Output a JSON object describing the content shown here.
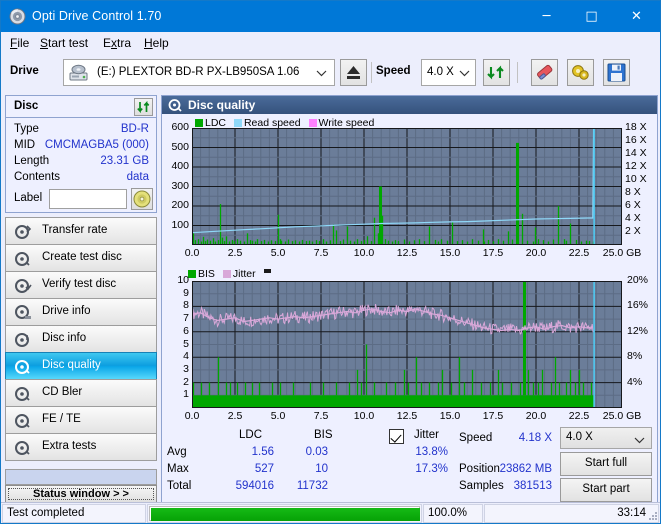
{
  "window": {
    "title": "Opti Drive Control 1.70",
    "icon": "disc-icon",
    "minimize": "─",
    "maximize": "□",
    "close": "✕"
  },
  "menu": [
    {
      "label": "File",
      "accel": "F"
    },
    {
      "label": "Start test",
      "accel": "S"
    },
    {
      "label": "Extra",
      "accel": "x"
    },
    {
      "label": "Help",
      "accel": "H"
    }
  ],
  "toolbar": {
    "drive_label": "Drive",
    "drive_value": "(E:)   PLEXTOR BD-R  PX-LB950SA 1.06",
    "drive_icon": "drive-icon",
    "eject_icon": "eject-icon",
    "speed_label": "Speed",
    "speed_value": "4.0 X",
    "refresh_icon": "refresh-icon",
    "erase_icon": "eraser-icon",
    "settings_icon": "gears-icon",
    "save_icon": "floppy-save-icon"
  },
  "disc": {
    "header": "Disc",
    "refresh_icon": "refresh-icon",
    "rows": [
      {
        "key": "Type",
        "value": "BD-R"
      },
      {
        "key": "MID",
        "value": "CMCMAGBA5 (000)"
      },
      {
        "key": "Length",
        "value": "23.31 GB"
      },
      {
        "key": "Contents",
        "value": "data"
      }
    ],
    "label_key": "Label",
    "label_value": "",
    "label_placeholder": "",
    "label_button_icon": "cd-disc-icon"
  },
  "nav": {
    "items": [
      {
        "label": "Transfer rate",
        "icon": "disc-transfer-icon",
        "selected": false
      },
      {
        "label": "Create test disc",
        "icon": "disc-create-icon",
        "selected": false
      },
      {
        "label": "Verify test disc",
        "icon": "disc-verify-icon",
        "selected": false
      },
      {
        "label": "Drive info",
        "icon": "drive-info-icon",
        "selected": false
      },
      {
        "label": "Disc info",
        "icon": "disc-info-icon",
        "selected": false
      },
      {
        "label": "Disc quality",
        "icon": "disc-quality-icon",
        "selected": true
      },
      {
        "label": "CD Bler",
        "icon": "disc-bler-icon",
        "selected": false
      },
      {
        "label": "FE / TE",
        "icon": "disc-fete-icon",
        "selected": false
      },
      {
        "label": "Extra tests",
        "icon": "disc-extra-icon",
        "selected": false
      }
    ],
    "status_window": "Status window > >"
  },
  "panel": {
    "title": "Disc quality",
    "icon": "disc-quality-icon"
  },
  "stats": {
    "col_ldc": "LDC",
    "col_bis": "BIS",
    "jitter_label": "Jitter",
    "jitter_checked": true,
    "row_avg": "Avg",
    "row_max": "Max",
    "row_total": "Total",
    "avg_ldc": "1.56",
    "avg_bis": "0.03",
    "avg_jitter": "13.8%",
    "max_ldc": "527",
    "max_bis": "10",
    "max_jitter": "17.3%",
    "total_ldc": "594016",
    "total_bis": "11732",
    "speed_label": "Speed",
    "speed_value": "4.18 X",
    "position_label": "Position",
    "position_value": "23862 MB",
    "samples_label": "Samples",
    "samples_value": "381513",
    "speed_select": "4.0 X",
    "start_full": "Start full",
    "start_part": "Start part"
  },
  "statusbar": {
    "message": "Test completed",
    "percent": "100.0%",
    "percent_value": 100,
    "elapsed": "33:14"
  },
  "colors": {
    "accent": "#0078d7",
    "ldc_green": "#00a800",
    "read_speed": "#8fd8f8",
    "write_speed": "#ff80ff",
    "jitter_pink": "#d9a8d9",
    "plot_bg": "#6b7d99",
    "value_blue": "#2233cc",
    "progress_green": "#09a809"
  },
  "chart_data": [
    {
      "type": "line",
      "name": "ldc-chart",
      "title": "",
      "xlabel": "GB",
      "ylabel": "",
      "xlim": [
        0,
        25
      ],
      "ylim": [
        0,
        600
      ],
      "y2lim": [
        0,
        18
      ],
      "y2label": "X",
      "grid": true,
      "legend_position": "top-left",
      "legend": [
        {
          "label": "LDC",
          "color": "#00a800"
        },
        {
          "label": "Read speed",
          "color": "#8fd8f8"
        },
        {
          "label": "Write speed",
          "color": "#ff80ff"
        }
      ],
      "yticks": [
        100,
        200,
        300,
        400,
        500,
        600
      ],
      "y2ticks": [
        "2 X",
        "4 X",
        "6 X",
        "8 X",
        "10 X",
        "12 X",
        "14 X",
        "16 X",
        "18 X"
      ],
      "xticks": [
        "0.0",
        "2.5",
        "5.0",
        "7.5",
        "10.0",
        "12.5",
        "15.0",
        "17.5",
        "20.0",
        "22.5",
        "25.0 GB"
      ],
      "series": [
        {
          "name": "LDC",
          "color": "#00a800",
          "render": "bars",
          "x": [
            0.05,
            0.2,
            0.35,
            0.5,
            0.62,
            0.78,
            0.9,
            1.05,
            1.2,
            1.35,
            1.5,
            1.62,
            1.72,
            1.85,
            2.0,
            2.15,
            2.3,
            2.45,
            2.6,
            2.8,
            3.0,
            3.2,
            3.4,
            3.5,
            3.65,
            3.8,
            4.0,
            4.2,
            4.4,
            4.6,
            4.8,
            5.0,
            5.1,
            5.2,
            5.4,
            5.6,
            5.8,
            6.0,
            6.2,
            6.4,
            6.6,
            6.8,
            7.0,
            7.2,
            7.4,
            7.6,
            7.8,
            8.0,
            8.2,
            8.4,
            8.6,
            8.8,
            9.0,
            9.2,
            9.4,
            9.6,
            9.8,
            10.0,
            10.2,
            10.4,
            10.6,
            10.8,
            10.95,
            11.05,
            11.2,
            11.4,
            11.6,
            11.8,
            12.0,
            12.3,
            12.6,
            12.9,
            13.2,
            13.5,
            13.8,
            14.1,
            14.3,
            14.5,
            14.8,
            15.1,
            15.4,
            15.7,
            16.0,
            16.3,
            16.6,
            16.9,
            17.0,
            17.2,
            17.5,
            17.8,
            18.1,
            18.4,
            18.6,
            18.9,
            19.2,
            19.5,
            19.8,
            19.95,
            20.1,
            20.4,
            20.7,
            21.0,
            21.3,
            21.6,
            21.75,
            22.0,
            22.3,
            22.6,
            22.9,
            23.1,
            23.3
          ],
          "values": [
            60,
            25,
            30,
            18,
            42,
            20,
            28,
            22,
            35,
            18,
            25,
            210,
            38,
            20,
            44,
            18,
            26,
            20,
            30,
            22,
            18,
            60,
            25,
            22,
            18,
            30,
            20,
            26,
            18,
            24,
            20,
            155,
            30,
            22,
            18,
            28,
            20,
            24,
            18,
            26,
            20,
            22,
            18,
            25,
            20,
            30,
            18,
            24,
            105,
            75,
            20,
            28,
            95,
            22,
            18,
            30,
            20,
            26,
            45,
            20,
            140,
            60,
            300,
            150,
            30,
            22,
            18,
            25,
            20,
            28,
            18,
            24,
            30,
            20,
            95,
            26,
            18,
            30,
            22,
            118,
            20,
            25,
            18,
            30,
            22,
            80,
            18,
            26,
            20,
            30,
            22,
            70,
            28,
            524,
            160,
            22,
            18,
            90,
            30,
            25,
            18,
            28,
            200,
            30,
            22,
            110,
            26,
            18,
            22,
            20,
            18
          ]
        },
        {
          "name": "Read speed",
          "color": "#8fd8f8",
          "render": "line",
          "axis": "y2",
          "x": [
            0.0,
            1.0,
            2.0,
            3.0,
            4.0,
            5.0,
            6.0,
            7.0,
            8.0,
            9.0,
            10.0,
            11.0,
            12.0,
            13.0,
            14.0,
            15.0,
            16.0,
            17.0,
            18.0,
            19.0,
            20.0,
            21.0,
            22.0,
            23.0,
            23.3,
            23.35
          ],
          "values": [
            1.9,
            2.05,
            2.2,
            2.35,
            2.5,
            2.65,
            2.8,
            2.9,
            3.0,
            3.1,
            3.2,
            3.3,
            3.35,
            3.4,
            3.5,
            3.55,
            3.6,
            3.7,
            3.8,
            3.9,
            4.0,
            4.05,
            4.1,
            4.15,
            4.15,
            18.0
          ]
        }
      ]
    },
    {
      "type": "line",
      "name": "bis-jitter-chart",
      "title": "",
      "xlabel": "GB",
      "ylabel": "",
      "xlim": [
        0,
        25
      ],
      "ylim": [
        0,
        10
      ],
      "y2lim": [
        0,
        20
      ],
      "y2label": "%",
      "grid": true,
      "legend_position": "top-left",
      "legend": [
        {
          "label": "BIS",
          "color": "#00a800"
        },
        {
          "label": "Jitter",
          "color": "#d9a8d9"
        }
      ],
      "yticks": [
        1,
        2,
        3,
        4,
        5,
        6,
        7,
        8,
        9,
        10
      ],
      "y2ticks": [
        "4%",
        "8%",
        "12%",
        "16%",
        "20%"
      ],
      "xticks": [
        "0.0",
        "2.5",
        "5.0",
        "7.5",
        "10.0",
        "12.5",
        "15.0",
        "17.5",
        "20.0",
        "22.5",
        "25.0 GB"
      ],
      "series": [
        {
          "name": "BIS",
          "color": "#00a800",
          "render": "bars",
          "baseline": 1,
          "x": [
            0.05,
            0.3,
            0.55,
            0.8,
            1.0,
            1.25,
            1.5,
            1.72,
            1.95,
            2.2,
            2.4,
            2.6,
            2.85,
            3.1,
            3.3,
            3.5,
            3.7,
            3.9,
            4.15,
            4.4,
            4.65,
            4.9,
            5.1,
            5.35,
            5.6,
            5.85,
            6.1,
            6.35,
            6.6,
            6.85,
            7.1,
            7.35,
            7.6,
            7.85,
            8.1,
            8.35,
            8.6,
            8.85,
            9.1,
            9.35,
            9.6,
            9.85,
            10.1,
            10.35,
            10.6,
            10.85,
            11.05,
            11.3,
            11.55,
            11.8,
            12.05,
            12.3,
            12.55,
            12.8,
            13.05,
            13.3,
            13.55,
            13.8,
            14.05,
            14.3,
            14.55,
            14.8,
            15.05,
            15.3,
            15.55,
            15.8,
            16.05,
            16.3,
            16.55,
            16.8,
            17.05,
            17.3,
            17.55,
            17.8,
            18.05,
            18.3,
            18.55,
            18.8,
            19.05,
            19.3,
            19.55,
            19.8,
            19.95,
            20.1,
            20.35,
            20.6,
            20.85,
            21.1,
            21.35,
            21.6,
            21.75,
            22.0,
            22.25,
            22.5,
            22.75,
            23.0,
            23.2,
            23.3
          ],
          "values": [
            2,
            1,
            2,
            1,
            2,
            1,
            4,
            1,
            2,
            2,
            1,
            2,
            1,
            2,
            1,
            2,
            1,
            2,
            1,
            1,
            2,
            1,
            2,
            1,
            1,
            2,
            1,
            1,
            1,
            2,
            1,
            1,
            2,
            1,
            1,
            2,
            1,
            1,
            2,
            1,
            3,
            2,
            5,
            1,
            2,
            1,
            1,
            2,
            1,
            2,
            1,
            3,
            2,
            1,
            4,
            2,
            1,
            2,
            1,
            2,
            3,
            1,
            2,
            1,
            4,
            2,
            1,
            3,
            1,
            2,
            1,
            2,
            1,
            3,
            2,
            1,
            2,
            1,
            2,
            10,
            3,
            2,
            1,
            2,
            3,
            1,
            2,
            4,
            2,
            1,
            2,
            3,
            2,
            3,
            2,
            1,
            2,
            1
          ]
        },
        {
          "name": "Jitter",
          "color": "#d9a8d9",
          "render": "line",
          "axis": "y2",
          "x": [
            0.0,
            0.5,
            1.0,
            1.5,
            2.0,
            2.5,
            3.0,
            3.5,
            4.0,
            4.5,
            5.0,
            5.5,
            6.0,
            6.5,
            7.0,
            7.5,
            8.0,
            8.5,
            9.0,
            9.5,
            10.0,
            10.5,
            11.0,
            11.5,
            12.0,
            12.5,
            13.0,
            13.5,
            14.0,
            14.5,
            15.0,
            15.5,
            16.0,
            16.5,
            17.0,
            17.5,
            18.0,
            18.5,
            19.0,
            19.5,
            20.0,
            20.5,
            21.0,
            21.5,
            22.0,
            22.5,
            23.0,
            23.3
          ],
          "values": [
            14.8,
            15.0,
            14.2,
            13.8,
            14.0,
            14.2,
            13.6,
            13.8,
            14.0,
            14.2,
            14.0,
            14.2,
            14.4,
            14.2,
            14.4,
            14.6,
            14.8,
            15.0,
            15.2,
            15.0,
            15.4,
            15.6,
            15.2,
            15.0,
            15.4,
            15.2,
            15.6,
            15.2,
            14.8,
            14.6,
            14.2,
            13.8,
            13.4,
            13.0,
            12.6,
            12.4,
            12.2,
            12.4,
            12.2,
            12.6,
            12.8,
            12.4,
            12.8,
            13.0,
            12.6,
            12.8,
            12.6,
            12.8
          ]
        }
      ]
    }
  ]
}
